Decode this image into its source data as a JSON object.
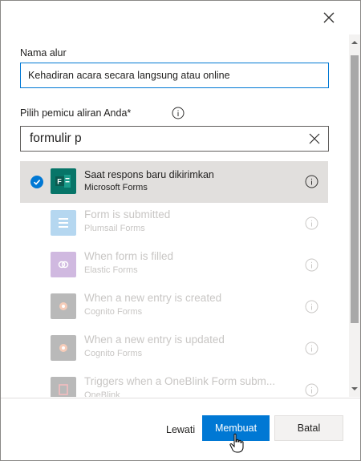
{
  "dialog": {
    "flow_name": {
      "label": "Nama alur",
      "value": "Kehadiran acara secara langsung atau online"
    },
    "trigger": {
      "label": "Pilih pemicu aliran Anda*",
      "search_value": "formulir p"
    },
    "triggers": [
      {
        "title": "Saat respons baru dikirimkan",
        "app": "Microsoft Forms",
        "selected": true,
        "icon": "microsoft-forms-icon",
        "color": "#077568"
      },
      {
        "title": "Form is submitted",
        "app": "Plumsail Forms",
        "selected": false,
        "icon": "plumsail-forms-icon",
        "color": "#2f8fd6"
      },
      {
        "title": "When form is filled",
        "app": "Elastic Forms",
        "selected": false,
        "icon": "elastic-forms-icon",
        "color": "#7a3aa8"
      },
      {
        "title": "When a new entry is created",
        "app": "Cognito Forms",
        "selected": false,
        "icon": "cognito-forms-icon",
        "color": "#3a3a3a"
      },
      {
        "title": "When a new entry is updated",
        "app": "Cognito Forms",
        "selected": false,
        "icon": "cognito-forms-icon",
        "color": "#3a3a3a"
      },
      {
        "title": "Triggers when a OneBlink Form subm...",
        "app": "OneBlink",
        "selected": false,
        "icon": "oneblink-icon",
        "color": "#3a3a3a"
      }
    ]
  },
  "footer": {
    "skip_label": "Lewati",
    "create_label": "Membuat",
    "cancel_label": "Batal"
  },
  "colors": {
    "accent": "#0078d4",
    "selected_row": "#e1dfdd",
    "disabled_text": "#c8c6c4"
  }
}
